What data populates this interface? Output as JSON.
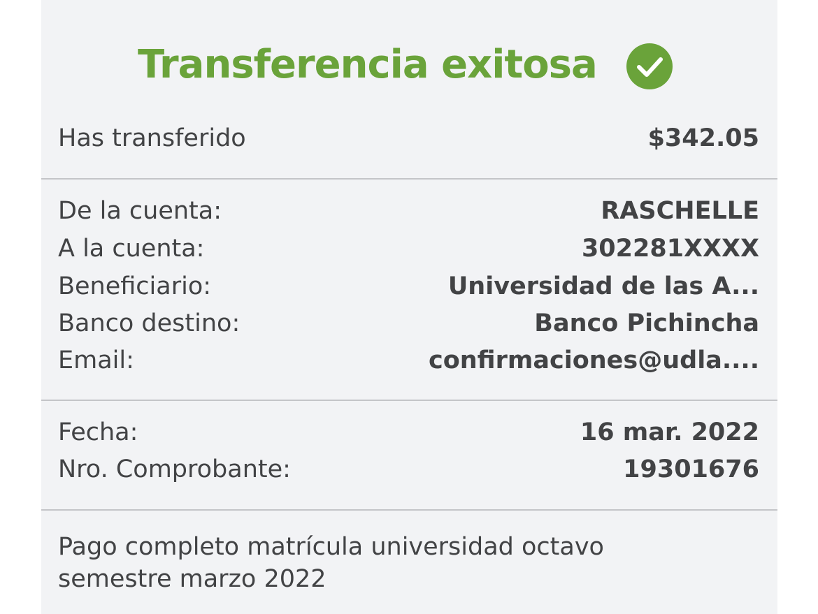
{
  "header": {
    "title": "Transferencia exitosa",
    "status_icon": "check-circle-icon",
    "accent_color": "#6aa33a"
  },
  "amount": {
    "label": "Has transferido",
    "value": "$342.05"
  },
  "details": [
    {
      "label": "De la cuenta:",
      "value": "RASCHELLE"
    },
    {
      "label": "A la cuenta:",
      "value": "302281XXXX"
    },
    {
      "label": "Beneficiario:",
      "value": "Universidad de las A..."
    },
    {
      "label": "Banco destino:",
      "value": "Banco Pichincha"
    },
    {
      "label": "Email:",
      "value": "confirmaciones@udla...."
    }
  ],
  "receipt": [
    {
      "label": "Fecha:",
      "value": "16 mar. 2022"
    },
    {
      "label": "Nro. Comprobante:",
      "value": "19301676"
    }
  ],
  "note": "Pago completo matrícula universidad  octavo semestre marzo 2022"
}
